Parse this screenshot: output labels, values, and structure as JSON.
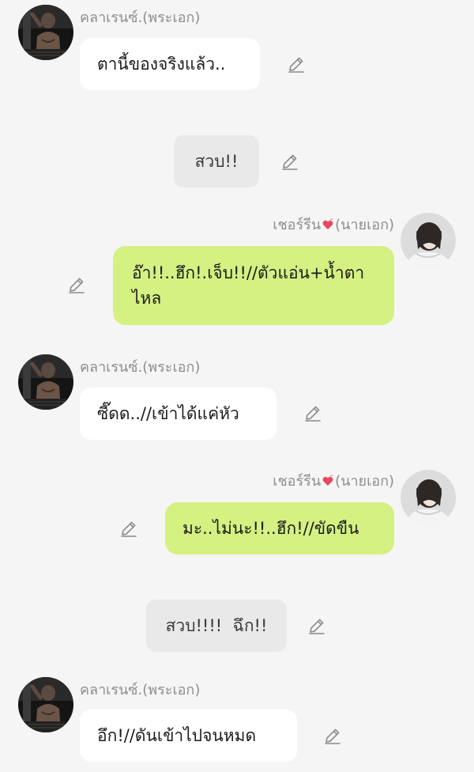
{
  "characters": {
    "clarence": {
      "name": "คลาเรนซ์.(พระเอก)",
      "avatar": "man-photo-avatar"
    },
    "cheoreen": {
      "name_prefix": "เชอร์รีน",
      "name_suffix": "(นายเอก)",
      "name_icon": "heart-icon",
      "avatar": "girl-photo-avatar"
    }
  },
  "messages": [
    {
      "speaker": "clarence",
      "text": "ตานี้ของจริงแล้ว.."
    },
    {
      "speaker": "narration",
      "text": "สวบ!!"
    },
    {
      "speaker": "cheoreen",
      "text": "อ๊า!!..ฮึก!.เจ็บ!!//ตัวแอ่น+น้ำตาไหล"
    },
    {
      "speaker": "clarence",
      "text": "ซี๊ดด..//เข้าได้แค่หัว"
    },
    {
      "speaker": "cheoreen",
      "text": "มะ..ไม่นะ!!..ฮึก!//ขัดขืน"
    },
    {
      "speaker": "narration",
      "text": "สวบ!!!!  ฉึก!!"
    },
    {
      "speaker": "clarence",
      "text": "อึก!//ดันเข้าไปจนหมด"
    }
  ],
  "colors": {
    "background": "#f5f5f5",
    "left_bubble": "#ffffff",
    "right_bubble": "#d5f182",
    "center_bubble": "#e9e9e9",
    "name_text": "#8e8e8e",
    "edit_icon": "#8a8a8a"
  },
  "icons": {
    "edit": "pencil-edit-icon"
  }
}
